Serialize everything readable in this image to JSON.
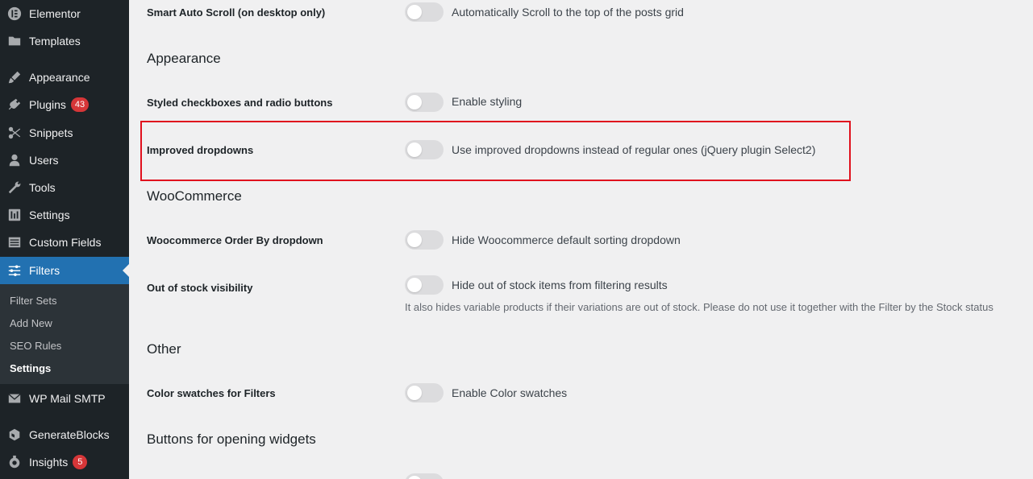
{
  "sidebar": {
    "items": [
      {
        "label": "Elementor",
        "icon": "elementor-icon"
      },
      {
        "label": "Templates",
        "icon": "folder-icon"
      },
      {
        "label": "Appearance",
        "icon": "paintbrush-icon"
      },
      {
        "label": "Plugins",
        "icon": "plug-icon",
        "badge": "43"
      },
      {
        "label": "Snippets",
        "icon": "scissors-icon"
      },
      {
        "label": "Users",
        "icon": "user-icon"
      },
      {
        "label": "Tools",
        "icon": "wrench-icon"
      },
      {
        "label": "Settings",
        "icon": "settings-icon"
      },
      {
        "label": "Custom Fields",
        "icon": "table-icon"
      },
      {
        "label": "Filters",
        "icon": "sliders-icon",
        "active": true
      },
      {
        "label": "WP Mail SMTP",
        "icon": "mail-icon"
      },
      {
        "label": "GenerateBlocks",
        "icon": "blocks-icon"
      },
      {
        "label": "Insights",
        "icon": "insights-icon",
        "badge": "5"
      }
    ],
    "submenu": [
      {
        "label": "Filter Sets"
      },
      {
        "label": "Add New"
      },
      {
        "label": "SEO Rules"
      },
      {
        "label": "Settings",
        "current": true
      }
    ]
  },
  "main": {
    "rows": {
      "smart_scroll": {
        "label": "Smart Auto Scroll (on desktop only)",
        "desc": "Automatically Scroll to the top of the posts grid"
      },
      "styled_checkboxes": {
        "label": "Styled checkboxes and radio buttons",
        "desc": "Enable styling"
      },
      "improved_dropdowns": {
        "label": "Improved dropdowns",
        "desc": "Use improved dropdowns instead of regular ones (jQuery plugin Select2)"
      },
      "woo_orderby": {
        "label": "Woocommerce Order By dropdown",
        "desc": "Hide Woocommerce default sorting dropdown"
      },
      "out_of_stock": {
        "label": "Out of stock visibility",
        "desc": "Hide out of stock items from filtering results",
        "note": "It also hides variable products if their variations are out of stock. Please do not use it together with the Filter by the Stock status"
      },
      "color_swatches": {
        "label": "Color swatches for Filters",
        "desc": "Enable Color swatches"
      }
    },
    "sections": {
      "appearance": "Appearance",
      "woocommerce": "WooCommerce",
      "other": "Other",
      "buttons": "Buttons for opening widgets"
    }
  },
  "colors": {
    "sidebar_bg": "#1d2327",
    "active_bg": "#2271b1",
    "highlight_border": "#e0101d",
    "badge_bg": "#d63638"
  }
}
